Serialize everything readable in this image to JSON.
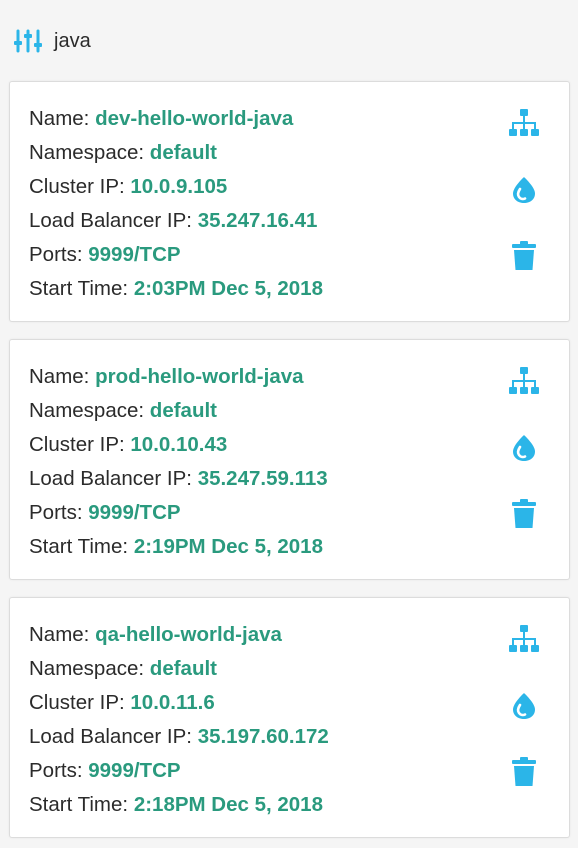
{
  "colors": {
    "accent_icon": "#2bb5e8",
    "value_text": "#2a9a7e",
    "label_text": "#2b2b2b",
    "card_bg": "#ffffff",
    "page_bg": "#f5f5f5"
  },
  "filter": {
    "icon": "sliders-icon",
    "text": "java"
  },
  "labels": {
    "name": "Name:",
    "namespace": "Namespace:",
    "cluster_ip": "Cluster IP:",
    "lb_ip": "Load Balancer IP:",
    "ports": "Ports:",
    "start_time": "Start Time:"
  },
  "action_icons": [
    "topology-icon",
    "droplet-icon",
    "trash-icon"
  ],
  "services": [
    {
      "name": "dev-hello-world-java",
      "namespace": "default",
      "cluster_ip": "10.0.9.105",
      "lb_ip": "35.247.16.41",
      "ports": "9999/TCP",
      "start_time": "2:03PM Dec 5, 2018"
    },
    {
      "name": "prod-hello-world-java",
      "namespace": "default",
      "cluster_ip": "10.0.10.43",
      "lb_ip": "35.247.59.113",
      "ports": "9999/TCP",
      "start_time": "2:19PM Dec 5, 2018"
    },
    {
      "name": "qa-hello-world-java",
      "namespace": "default",
      "cluster_ip": "10.0.11.6",
      "lb_ip": "35.197.60.172",
      "ports": "9999/TCP",
      "start_time": "2:18PM Dec 5, 2018"
    }
  ]
}
